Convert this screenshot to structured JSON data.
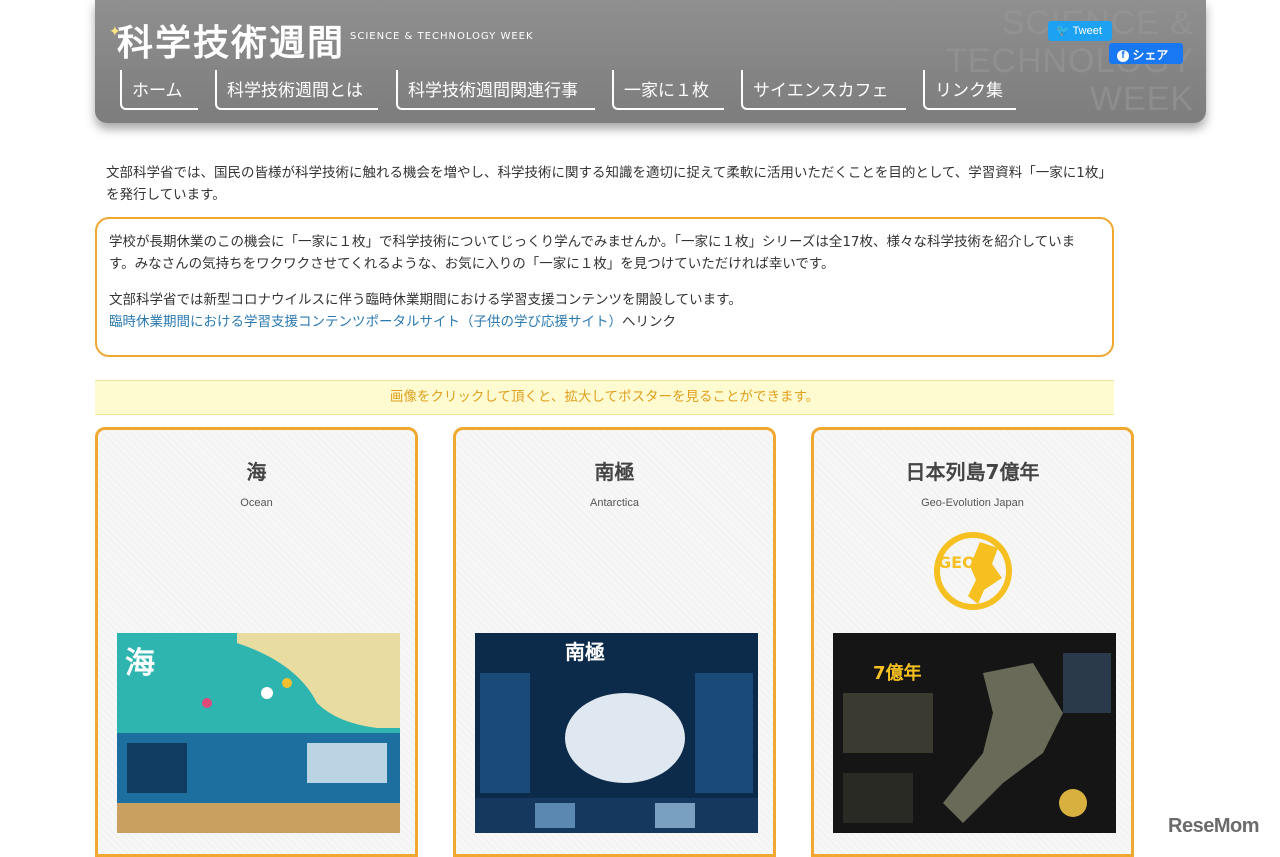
{
  "header": {
    "site_title": "科学技術週間",
    "site_subtitle": "SCIENCE & TECHNOLOGY WEEK",
    "bg_text_line1": "SCIENCE &",
    "bg_text_line2": "TECHNOLOGY",
    "bg_text_line3": "WEEK",
    "nav": [
      {
        "label": "ホーム"
      },
      {
        "label": "科学技術週間とは"
      },
      {
        "label": "科学技術週間関連行事"
      },
      {
        "label": "一家に１枚"
      },
      {
        "label": "サイエンスカフェ"
      },
      {
        "label": "リンク集"
      }
    ],
    "tweet_label": "Tweet",
    "share_label": "シェア"
  },
  "intro": {
    "text": "文部科学省では、国民の皆様が科学技術に触れる機会を増やし、科学技術に関する知識を適切に捉えて柔軟に活用いただくことを目的として、学習資料「一家に1枚」を発行しています。"
  },
  "notice": {
    "paragraph1": "学校が長期休業のこの機会に「一家に１枚」で科学技術についてじっくり学んでみませんか。「一家に１枚」シリーズは全17枚、様々な科学技術を紹介しています。みなさんの気持ちをワクワクさせてくれるような、お気に入りの「一家に１枚」を見つけていただければ幸いです。",
    "paragraph2": "文部科学省では新型コロナウイルスに伴う臨時休業期間における学習支援コンテンツを開設しています。",
    "link_text": "臨時休業期間における学習支援コンテンツポータルサイト（子供の学び応援サイト）",
    "link_suffix": "へリンク"
  },
  "hint_bar": {
    "text": "画像をクリックして頂くと、拡大してポスターを見ることができます。"
  },
  "cards": [
    {
      "title": "海",
      "subtitle": "Ocean",
      "poster_title": "海"
    },
    {
      "title": "南極",
      "subtitle": "Antarctica",
      "poster_title": "南極"
    },
    {
      "title": "日本列島7億年",
      "subtitle": "Geo-Evolution Japan",
      "logo_text": "GEO",
      "poster_title": "7億年"
    }
  ],
  "watermark": "ReseMom",
  "colors": {
    "accent_orange": "#f0a830",
    "link_blue": "#2a7ab0",
    "header_gray": "#888888",
    "tweet_blue": "#1da1f2",
    "facebook_blue": "#1877f2",
    "hint_bg": "#fffbd0"
  }
}
